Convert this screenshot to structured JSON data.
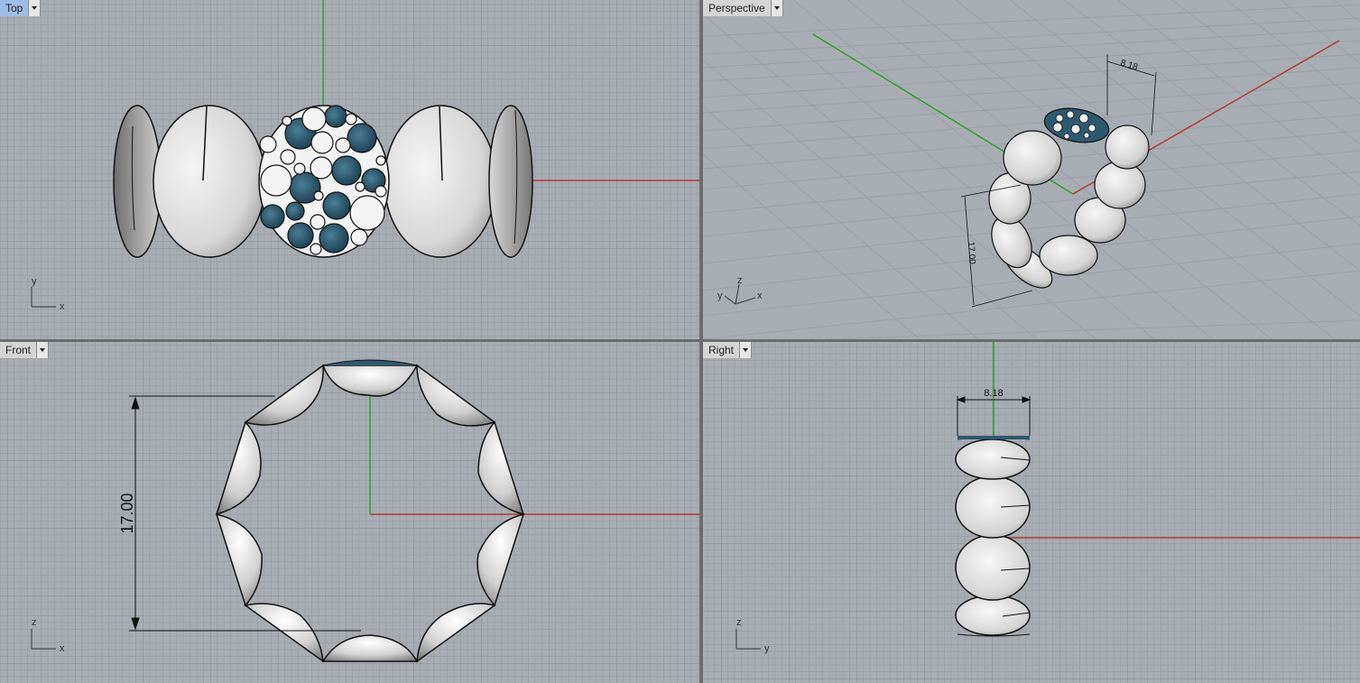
{
  "viewports": {
    "top": {
      "label": "Top",
      "active": true,
      "axis_labels": [
        "y",
        "x"
      ]
    },
    "perspective": {
      "label": "Perspective",
      "active": false,
      "axis_labels": [
        "y",
        "z",
        "x"
      ],
      "dims": {
        "width": "8.18",
        "diameter": "17.00"
      }
    },
    "front": {
      "label": "Front",
      "active": false,
      "axis_labels": [
        "z",
        "x"
      ],
      "dims": {
        "diameter": "17.00"
      }
    },
    "right": {
      "label": "Right",
      "active": false,
      "axis_labels": [
        "z",
        "y"
      ],
      "dims": {
        "width": "8.18"
      }
    }
  },
  "colors": {
    "background": "#a8adb4",
    "grid_minor": "#9ba0a7",
    "grid_major": "#8c9199",
    "x_axis": "#b03a2e",
    "y_axis": "#2e9e2e",
    "gem_blue": "#2a5a70",
    "metal": "#e8e8e8"
  }
}
